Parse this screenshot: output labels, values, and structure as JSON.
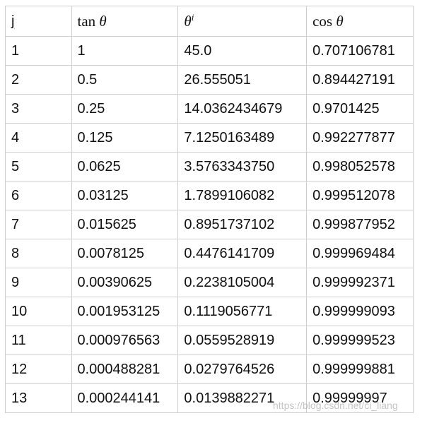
{
  "table": {
    "headers": {
      "j": "j",
      "tan_fn": "tan",
      "tan_var": "θ",
      "theta_var": "θ",
      "theta_sup": "i",
      "cos_fn": "cos",
      "cos_var": "θ"
    },
    "rows": [
      [
        "1",
        "1",
        "45.0",
        "0.707106781"
      ],
      [
        "2",
        "0.5",
        "26.555051",
        "0.894427191"
      ],
      [
        "3",
        "0.25",
        "14.0362434679",
        "0.9701425"
      ],
      [
        "4",
        "0.125",
        "7.1250163489",
        "0.992277877"
      ],
      [
        "5",
        "0.0625",
        "3.5763343750",
        "0.998052578"
      ],
      [
        "6",
        "0.03125",
        "1.7899106082",
        "0.999512078"
      ],
      [
        "7",
        "0.015625",
        "0.8951737102",
        "0.999877952"
      ],
      [
        "8",
        "0.0078125",
        "0.4476141709",
        "0.999969484"
      ],
      [
        "9",
        "0.00390625",
        "0.2238105004",
        "0.999992371"
      ],
      [
        "10",
        "0.001953125",
        "0.1119056771",
        "0.999999093"
      ],
      [
        "11",
        "0.000976563",
        "0.0559528919",
        "0.999999523"
      ],
      [
        "12",
        "0.000488281",
        "0.0279764526",
        "0.999999881"
      ],
      [
        "13",
        "0.000244141",
        "0.0139882271",
        "0.99999997"
      ]
    ]
  },
  "watermark": "https://blog.csdn.net/ci_liang"
}
